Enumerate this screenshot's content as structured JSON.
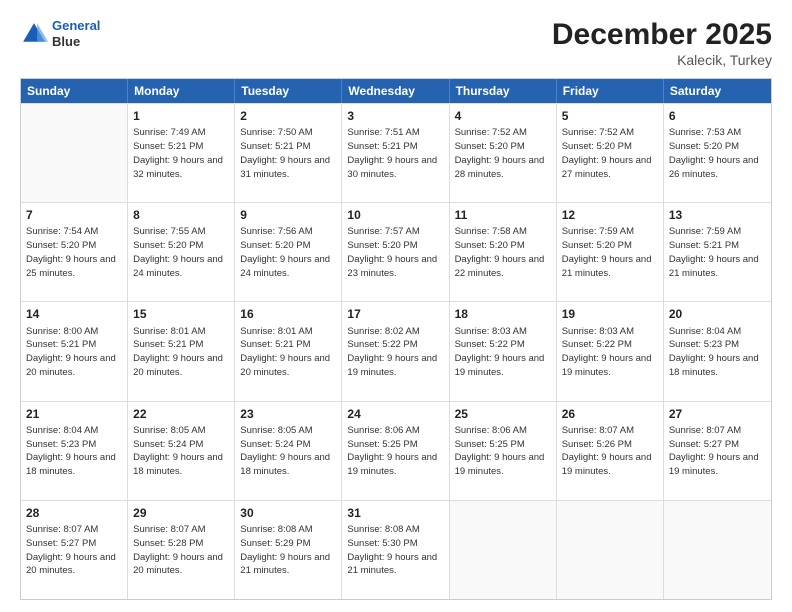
{
  "header": {
    "logo_line1": "General",
    "logo_line2": "Blue",
    "month_year": "December 2025",
    "location": "Kalecik, Turkey"
  },
  "weekdays": [
    "Sunday",
    "Monday",
    "Tuesday",
    "Wednesday",
    "Thursday",
    "Friday",
    "Saturday"
  ],
  "rows": [
    [
      {
        "day": "",
        "empty": true
      },
      {
        "day": "1",
        "rise": "7:49 AM",
        "set": "5:21 PM",
        "daylight": "9 hours and 32 minutes."
      },
      {
        "day": "2",
        "rise": "7:50 AM",
        "set": "5:21 PM",
        "daylight": "9 hours and 31 minutes."
      },
      {
        "day": "3",
        "rise": "7:51 AM",
        "set": "5:21 PM",
        "daylight": "9 hours and 30 minutes."
      },
      {
        "day": "4",
        "rise": "7:52 AM",
        "set": "5:20 PM",
        "daylight": "9 hours and 28 minutes."
      },
      {
        "day": "5",
        "rise": "7:52 AM",
        "set": "5:20 PM",
        "daylight": "9 hours and 27 minutes."
      },
      {
        "day": "6",
        "rise": "7:53 AM",
        "set": "5:20 PM",
        "daylight": "9 hours and 26 minutes."
      }
    ],
    [
      {
        "day": "7",
        "rise": "7:54 AM",
        "set": "5:20 PM",
        "daylight": "9 hours and 25 minutes."
      },
      {
        "day": "8",
        "rise": "7:55 AM",
        "set": "5:20 PM",
        "daylight": "9 hours and 24 minutes."
      },
      {
        "day": "9",
        "rise": "7:56 AM",
        "set": "5:20 PM",
        "daylight": "9 hours and 24 minutes."
      },
      {
        "day": "10",
        "rise": "7:57 AM",
        "set": "5:20 PM",
        "daylight": "9 hours and 23 minutes."
      },
      {
        "day": "11",
        "rise": "7:58 AM",
        "set": "5:20 PM",
        "daylight": "9 hours and 22 minutes."
      },
      {
        "day": "12",
        "rise": "7:59 AM",
        "set": "5:20 PM",
        "daylight": "9 hours and 21 minutes."
      },
      {
        "day": "13",
        "rise": "7:59 AM",
        "set": "5:21 PM",
        "daylight": "9 hours and 21 minutes."
      }
    ],
    [
      {
        "day": "14",
        "rise": "8:00 AM",
        "set": "5:21 PM",
        "daylight": "9 hours and 20 minutes."
      },
      {
        "day": "15",
        "rise": "8:01 AM",
        "set": "5:21 PM",
        "daylight": "9 hours and 20 minutes."
      },
      {
        "day": "16",
        "rise": "8:01 AM",
        "set": "5:21 PM",
        "daylight": "9 hours and 20 minutes."
      },
      {
        "day": "17",
        "rise": "8:02 AM",
        "set": "5:22 PM",
        "daylight": "9 hours and 19 minutes."
      },
      {
        "day": "18",
        "rise": "8:03 AM",
        "set": "5:22 PM",
        "daylight": "9 hours and 19 minutes."
      },
      {
        "day": "19",
        "rise": "8:03 AM",
        "set": "5:22 PM",
        "daylight": "9 hours and 19 minutes."
      },
      {
        "day": "20",
        "rise": "8:04 AM",
        "set": "5:23 PM",
        "daylight": "9 hours and 18 minutes."
      }
    ],
    [
      {
        "day": "21",
        "rise": "8:04 AM",
        "set": "5:23 PM",
        "daylight": "9 hours and 18 minutes."
      },
      {
        "day": "22",
        "rise": "8:05 AM",
        "set": "5:24 PM",
        "daylight": "9 hours and 18 minutes."
      },
      {
        "day": "23",
        "rise": "8:05 AM",
        "set": "5:24 PM",
        "daylight": "9 hours and 18 minutes."
      },
      {
        "day": "24",
        "rise": "8:06 AM",
        "set": "5:25 PM",
        "daylight": "9 hours and 19 minutes."
      },
      {
        "day": "25",
        "rise": "8:06 AM",
        "set": "5:25 PM",
        "daylight": "9 hours and 19 minutes."
      },
      {
        "day": "26",
        "rise": "8:07 AM",
        "set": "5:26 PM",
        "daylight": "9 hours and 19 minutes."
      },
      {
        "day": "27",
        "rise": "8:07 AM",
        "set": "5:27 PM",
        "daylight": "9 hours and 19 minutes."
      }
    ],
    [
      {
        "day": "28",
        "rise": "8:07 AM",
        "set": "5:27 PM",
        "daylight": "9 hours and 20 minutes."
      },
      {
        "day": "29",
        "rise": "8:07 AM",
        "set": "5:28 PM",
        "daylight": "9 hours and 20 minutes."
      },
      {
        "day": "30",
        "rise": "8:08 AM",
        "set": "5:29 PM",
        "daylight": "9 hours and 21 minutes."
      },
      {
        "day": "31",
        "rise": "8:08 AM",
        "set": "5:30 PM",
        "daylight": "9 hours and 21 minutes."
      },
      {
        "day": "",
        "empty": true
      },
      {
        "day": "",
        "empty": true
      },
      {
        "day": "",
        "empty": true
      }
    ]
  ]
}
